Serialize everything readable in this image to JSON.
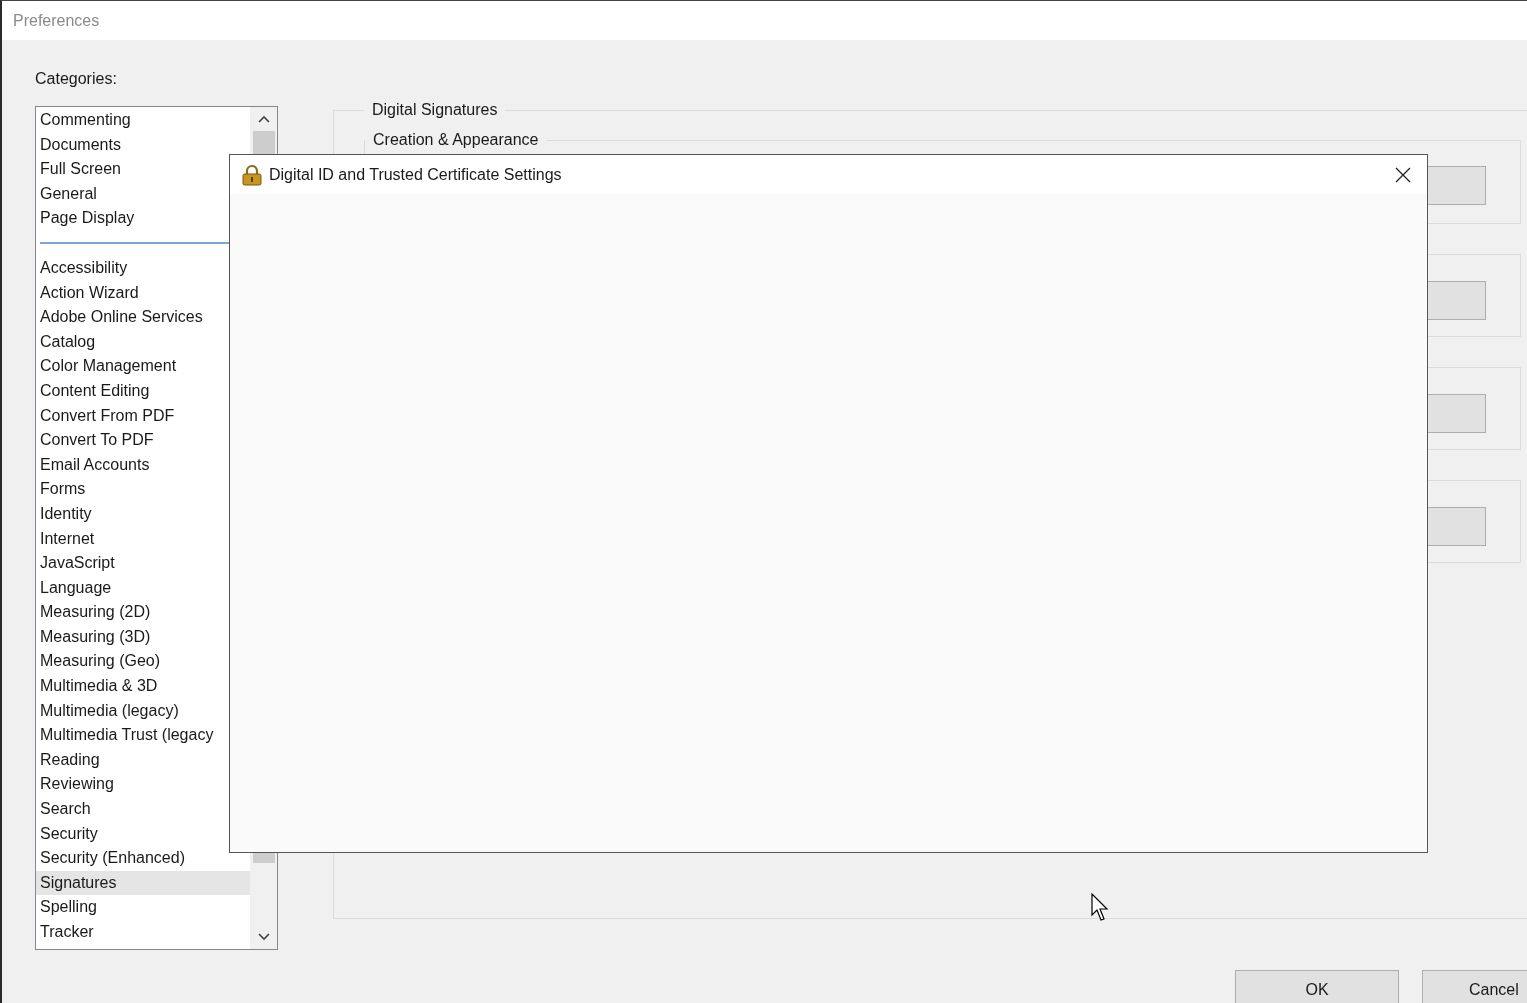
{
  "window": {
    "title": "Preferences"
  },
  "categories_label": "Categories:",
  "categories": {
    "pinned": [
      {
        "label": "Commenting",
        "selected": false
      },
      {
        "label": "Documents",
        "selected": false
      },
      {
        "label": "Full Screen",
        "selected": false
      },
      {
        "label": "General",
        "selected": false
      },
      {
        "label": "Page Display",
        "selected": false
      }
    ],
    "all": [
      {
        "label": "Accessibility",
        "selected": false
      },
      {
        "label": "Action Wizard",
        "selected": false
      },
      {
        "label": "Adobe Online Services",
        "selected": false
      },
      {
        "label": "Catalog",
        "selected": false
      },
      {
        "label": "Color Management",
        "selected": false
      },
      {
        "label": "Content Editing",
        "selected": false
      },
      {
        "label": "Convert From PDF",
        "selected": false
      },
      {
        "label": "Convert To PDF",
        "selected": false
      },
      {
        "label": "Email Accounts",
        "selected": false
      },
      {
        "label": "Forms",
        "selected": false
      },
      {
        "label": "Identity",
        "selected": false
      },
      {
        "label": "Internet",
        "selected": false
      },
      {
        "label": "JavaScript",
        "selected": false
      },
      {
        "label": "Language",
        "selected": false
      },
      {
        "label": "Measuring (2D)",
        "selected": false
      },
      {
        "label": "Measuring (3D)",
        "selected": false
      },
      {
        "label": "Measuring (Geo)",
        "selected": false
      },
      {
        "label": "Multimedia & 3D",
        "selected": false
      },
      {
        "label": "Multimedia (legacy)",
        "selected": false
      },
      {
        "label": "Multimedia Trust (legacy",
        "selected": false
      },
      {
        "label": "Reading",
        "selected": false
      },
      {
        "label": "Reviewing",
        "selected": false
      },
      {
        "label": "Search",
        "selected": false
      },
      {
        "label": "Security",
        "selected": false
      },
      {
        "label": "Security (Enhanced)",
        "selected": false
      },
      {
        "label": "Signatures",
        "selected": true
      },
      {
        "label": "Spelling",
        "selected": false
      },
      {
        "label": "Tracker",
        "selected": false
      }
    ]
  },
  "panel": {
    "title": "Digital Signatures",
    "sections": [
      {
        "kind": "titled",
        "title": "Creation & Appearance"
      },
      {
        "kind": "untitled"
      },
      {
        "kind": "untitled"
      },
      {
        "kind": "untitled"
      }
    ]
  },
  "dialog": {
    "title": "Digital ID and Trusted Certificate Settings"
  },
  "buttons": [
    "OK",
    "Cancel"
  ]
}
